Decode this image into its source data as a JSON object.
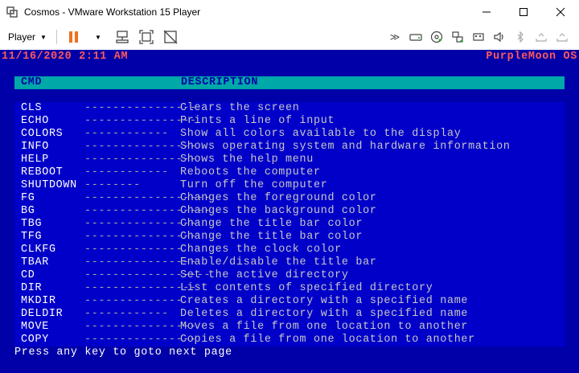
{
  "window": {
    "title": "Cosmos - VMware Workstation 15 Player",
    "minimize": "—",
    "maximize": "☐",
    "close": "✕"
  },
  "toolbar": {
    "player_label": "Player"
  },
  "os": {
    "clock": "11/16/2020 2:11 AM",
    "name": "PurpleMoon OS"
  },
  "help": {
    "header_cmd": "CMD",
    "header_desc": "DESCRIPTION",
    "commands": [
      {
        "cmd": "CLS",
        "dash": "----------------",
        "desc": "Clears the screen"
      },
      {
        "cmd": "ECHO",
        "dash": "----------------",
        "desc": "Prints a line of input"
      },
      {
        "cmd": "COLORS",
        "dash": "------------",
        "desc": "Show all colors available to the display"
      },
      {
        "cmd": "INFO",
        "dash": "----------------",
        "desc": "Shows operating system and hardware information"
      },
      {
        "cmd": "HELP",
        "dash": "----------------",
        "desc": "Shows the help menu"
      },
      {
        "cmd": "REBOOT",
        "dash": "------------",
        "desc": "Reboots the computer"
      },
      {
        "cmd": "SHUTDOWN",
        "dash": "--------",
        "desc": "Turn off the computer"
      },
      {
        "cmd": "FG",
        "dash": "------------------",
        "desc": "Changes the foreground color"
      },
      {
        "cmd": "BG",
        "dash": "------------------",
        "desc": "Changes the background color"
      },
      {
        "cmd": "TBG",
        "dash": "----------------",
        "desc": "Change the title bar color"
      },
      {
        "cmd": "TFG",
        "dash": "----------------",
        "desc": "Change the title bar color"
      },
      {
        "cmd": "CLKFG",
        "dash": "--------------",
        "desc": "Changes the clock color"
      },
      {
        "cmd": "TBAR",
        "dash": "----------------",
        "desc": "Enable/disable the title bar"
      },
      {
        "cmd": "CD",
        "dash": "------------------",
        "desc": "Set the active directory"
      },
      {
        "cmd": "DIR",
        "dash": "----------------",
        "desc": "List contents of specified directory"
      },
      {
        "cmd": "MKDIR",
        "dash": "--------------",
        "desc": "Creates a directory with a specified name"
      },
      {
        "cmd": "DELDIR",
        "dash": "------------",
        "desc": "Deletes a directory with a specified name"
      },
      {
        "cmd": "MOVE",
        "dash": "----------------",
        "desc": "Moves a file from one location to another"
      },
      {
        "cmd": "COPY",
        "dash": "----------------",
        "desc": "Copies a file from one location to another"
      }
    ],
    "prompt": "Press any key to goto next page"
  },
  "colors": {
    "console_bg": "#0000a8",
    "panel_bg": "#0000c8",
    "header_bg": "#00a8a8",
    "status_text": "#ff5a5a",
    "pause_icon": "#f07020"
  }
}
